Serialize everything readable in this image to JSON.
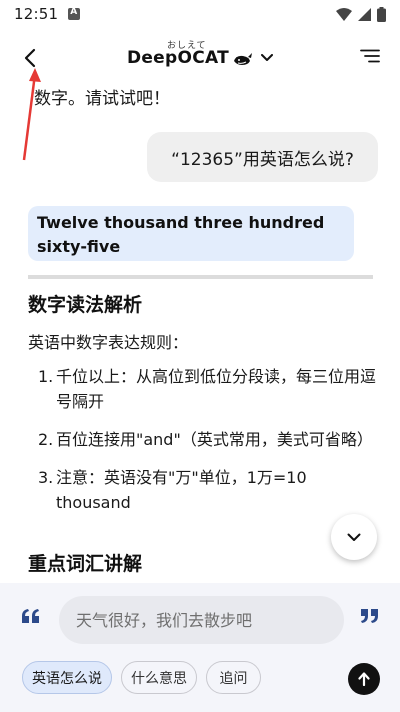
{
  "status_bar": {
    "time": "12:51"
  },
  "header": {
    "title": "DeepOCAT",
    "title_ruby": "おしえて"
  },
  "chat": {
    "prev_text": "数字。请试试吧！",
    "user_message": "“12365”用英语怎么说?",
    "answer": "Twelve thousand three hundred sixty-five",
    "section1_title": "数字读法解析",
    "intro": "英语中数字表达规则：",
    "rules": [
      {
        "num": "1.",
        "text": "千位以上：从高位到低位分段读，每三位用逗号隔开"
      },
      {
        "num": "2.",
        "text": "百位连接用\"and\"（英式常用，美式可省略）"
      },
      {
        "num": "3.",
        "text": "注意：英语没有\"万\"单位，1万=10 thousand"
      }
    ],
    "section2_title": "重点词汇讲解"
  },
  "input": {
    "placeholder": "天气很好，我们去散步吧"
  },
  "chips": [
    {
      "label": "英语怎么说"
    },
    {
      "label": "什么意思"
    },
    {
      "label": "追问"
    }
  ],
  "colors": {
    "answer_bg": "#e3edfc",
    "user_bubble_bg": "#efefef",
    "accent_quote": "#2c4a8a",
    "annotation": "#e53935"
  }
}
